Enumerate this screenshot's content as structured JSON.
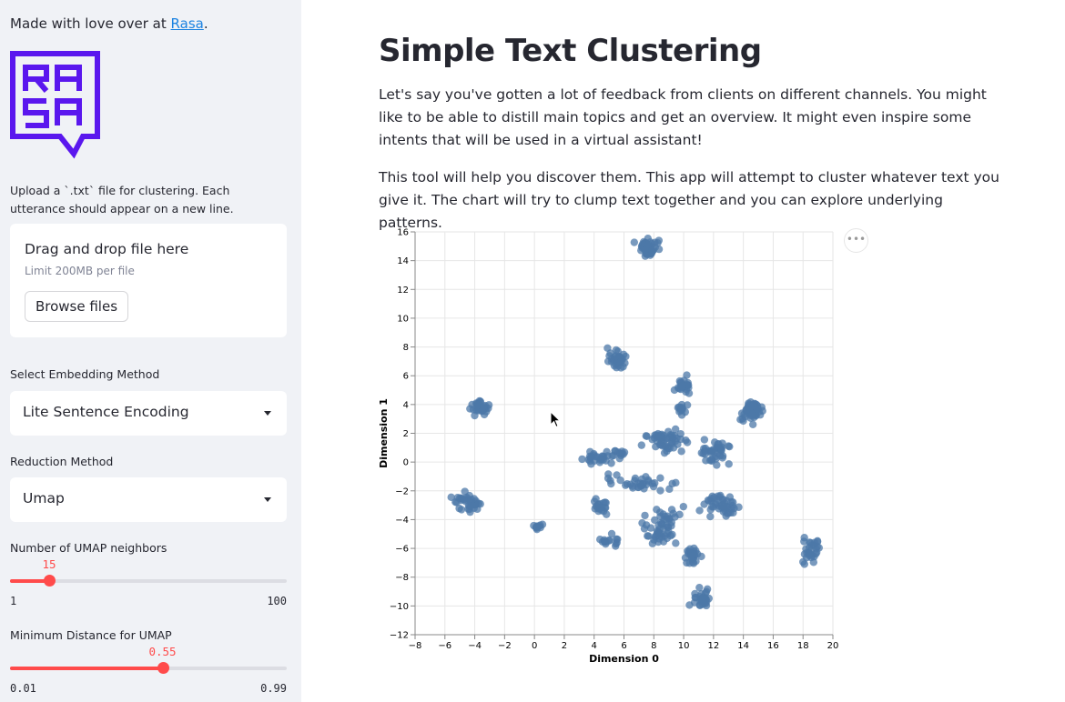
{
  "sidebar": {
    "credit_prefix": "Made with love over at ",
    "credit_link": "Rasa",
    "credit_suffix": ".",
    "logo": {
      "name": "rasa-logo",
      "text": "RASA",
      "color": "#5a17ee"
    },
    "upload": {
      "instruction": "Upload a `.txt` file for clustering. Each utterance should appear on a new line.",
      "drag_text": "Drag and drop file here",
      "limit_text": "Limit 200MB per file",
      "browse_label": "Browse files"
    },
    "embedding": {
      "label": "Select Embedding Method",
      "value": "Lite Sentence Encoding"
    },
    "reduction": {
      "label": "Reduction Method",
      "value": "Umap"
    },
    "neighbors": {
      "label": "Number of UMAP neighbors",
      "value": "15",
      "min": "1",
      "max": "100",
      "fraction": 0.1414
    },
    "min_dist": {
      "label": "Minimum Distance for UMAP",
      "value": "0.55",
      "min": "0.01",
      "max": "0.99",
      "fraction": 0.551
    }
  },
  "main": {
    "title": "Simple Text Clustering",
    "paragraph1": "Let's say you've gotten a lot of feedback from clients on different channels. You might like to be able to distill main topics and get an overview. It might even inspire some intents that will be used in a virtual assistant!",
    "paragraph2": "This tool will help you discover them. This app will attempt to cluster whatever text you give it. The chart will try to clump text together and you can explore underlying patterns.",
    "chart_menu_label": "•••"
  },
  "colors": {
    "accent": "#ff4b4b",
    "point": "#4c78a8",
    "link": "#1c83e1",
    "sidebar_bg": "#f0f2f6"
  },
  "chart_data": {
    "type": "scatter",
    "xlabel": "Dimension 0",
    "ylabel": "Dimension 1",
    "xlim": [
      -8,
      20
    ],
    "ylim": [
      -12,
      16
    ],
    "xticks": [
      -8,
      -6,
      -4,
      -2,
      0,
      2,
      4,
      6,
      8,
      10,
      12,
      14,
      16,
      18,
      20
    ],
    "yticks": [
      -12,
      -10,
      -8,
      -6,
      -4,
      -2,
      0,
      2,
      4,
      6,
      8,
      10,
      12,
      14,
      16
    ],
    "grid": true,
    "clusters": [
      {
        "x": 7.5,
        "y": 15.0,
        "spread": [
          0.6,
          0.6
        ],
        "n": 40
      },
      {
        "x": 5.5,
        "y": 7.2,
        "spread": [
          0.45,
          0.55
        ],
        "n": 35
      },
      {
        "x": 10.0,
        "y": 5.3,
        "spread": [
          0.45,
          0.45
        ],
        "n": 25
      },
      {
        "x": 9.8,
        "y": 3.8,
        "spread": [
          0.3,
          0.5
        ],
        "n": 12
      },
      {
        "x": -3.7,
        "y": 3.8,
        "spread": [
          0.45,
          0.45
        ],
        "n": 35
      },
      {
        "x": 14.5,
        "y": 3.5,
        "spread": [
          0.6,
          0.6
        ],
        "n": 45
      },
      {
        "x": 8.8,
        "y": 1.5,
        "spread": [
          1.2,
          0.6
        ],
        "n": 50
      },
      {
        "x": 12.0,
        "y": 0.7,
        "spread": [
          0.8,
          0.7
        ],
        "n": 40
      },
      {
        "x": 4.0,
        "y": 0.3,
        "spread": [
          0.8,
          0.4
        ],
        "n": 25
      },
      {
        "x": 5.5,
        "y": 0.7,
        "spread": [
          0.5,
          0.4
        ],
        "n": 12
      },
      {
        "x": 7.0,
        "y": -1.5,
        "spread": [
          1.6,
          0.5
        ],
        "n": 35
      },
      {
        "x": 12.5,
        "y": -3.0,
        "spread": [
          1.0,
          0.6
        ],
        "n": 45
      },
      {
        "x": 4.4,
        "y": -3.0,
        "spread": [
          0.4,
          0.6
        ],
        "n": 20
      },
      {
        "x": 8.5,
        "y": -4.5,
        "spread": [
          1.0,
          1.2
        ],
        "n": 55
      },
      {
        "x": -4.5,
        "y": -2.8,
        "spread": [
          1.0,
          0.6
        ],
        "n": 35
      },
      {
        "x": 0.2,
        "y": -4.5,
        "spread": [
          0.3,
          0.2
        ],
        "n": 10
      },
      {
        "x": 5.0,
        "y": -5.5,
        "spread": [
          0.5,
          0.4
        ],
        "n": 15
      },
      {
        "x": 10.6,
        "y": -6.5,
        "spread": [
          0.4,
          0.5
        ],
        "n": 25
      },
      {
        "x": 11.2,
        "y": -9.5,
        "spread": [
          0.5,
          0.6
        ],
        "n": 30
      },
      {
        "x": 18.6,
        "y": -6.3,
        "spread": [
          0.5,
          0.7
        ],
        "n": 30
      }
    ]
  }
}
